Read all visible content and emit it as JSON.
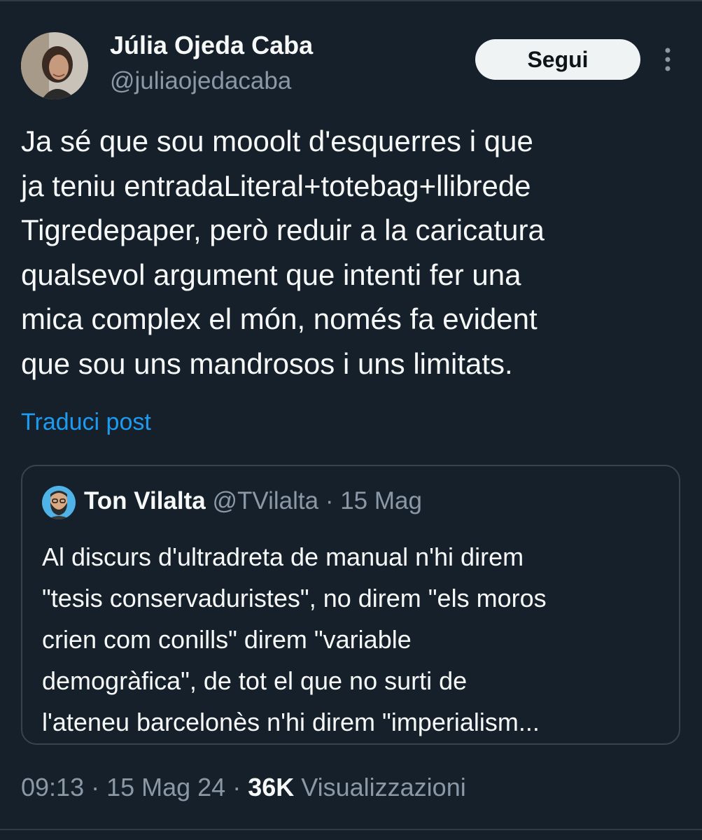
{
  "tweet": {
    "author": {
      "name": "Júlia Ojeda Caba",
      "handle": "@juliaojedacaba"
    },
    "follow_label": "Segui",
    "text_lines": [
      "Ja sé que sou mooolt d'esquerres i que",
      "ja teniu entradaLiteral+totebag+llibrede",
      "Tigredepaper, però reduir a la caricatura",
      "qualsevol argument que intenti fer una",
      "mica complex el món, només fa evident",
      "que sou uns mandrosos i uns limitats."
    ],
    "translate_label": "Traduci post",
    "quoted": {
      "name": "Ton Vilalta",
      "meta": "@TVilalta · 15 Mag",
      "text_lines": [
        "Al discurs d'ultradreta de manual n'hi direm",
        "\"tesis conservaduristes\", no direm \"els moros",
        "crien com conills\" direm \"variable",
        "demogràfica\", de tot el que no surti de",
        "l'ateneu barcelonès n'hi direm \"imperialism..."
      ]
    },
    "footer": {
      "time_date": "09:13 · 15 Mag 24 · ",
      "views_count": "36K",
      "views_label": " Visualizzazioni"
    }
  },
  "icons": {
    "more": "more-vertical-icon"
  },
  "colors": {
    "background": "#15202b",
    "text": "#f7f9f9",
    "secondary": "#8b98a5",
    "link": "#1d9bf0",
    "border": "#38444d"
  }
}
